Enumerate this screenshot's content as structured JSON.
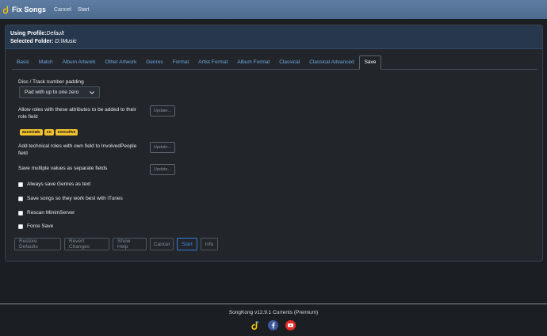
{
  "topbar": {
    "brand": "Fix Songs",
    "nav": [
      "Cancel",
      "Start"
    ]
  },
  "panel": {
    "profile_label": "Using Profile:",
    "profile_value": "Default",
    "folder_label": "Selected Folder: ",
    "folder_value": "D:\\Music"
  },
  "tabs": [
    "Basic",
    "Match",
    "Album Artwork",
    "Other Artwork",
    "Genres",
    "Format",
    "Artist Format",
    "Album Format",
    "Classical",
    "Classical Advanced",
    "Save"
  ],
  "active_tab": "Save",
  "form": {
    "padding_label": "Disc / Track number padding",
    "padding_value": "Pad with up to one zero",
    "roles_label": "Allow roles with these attributes to be added to their role field",
    "roles_badges": [
      "associate",
      "co",
      "executive"
    ],
    "technical_label": "Add technical roles with own field to InvolvedPeople field",
    "multiple_label": "Save multiple values as separate fields",
    "update_label": "Update...",
    "checks": [
      "Always save Genres as text",
      "Save songs so they work best with iTunes",
      "Rescan MinimServer",
      "Force Save"
    ]
  },
  "buttons": [
    "Restore Defaults",
    "Revert Changes",
    "Show Help",
    "Cancel",
    "Start",
    "Info"
  ],
  "footer": {
    "text": "SongKong v12.9.1 Currents (Premium)"
  },
  "colors": {
    "accent": "#3f86e0",
    "badge": "#f2c12e",
    "topbar": "#5f7da2"
  }
}
